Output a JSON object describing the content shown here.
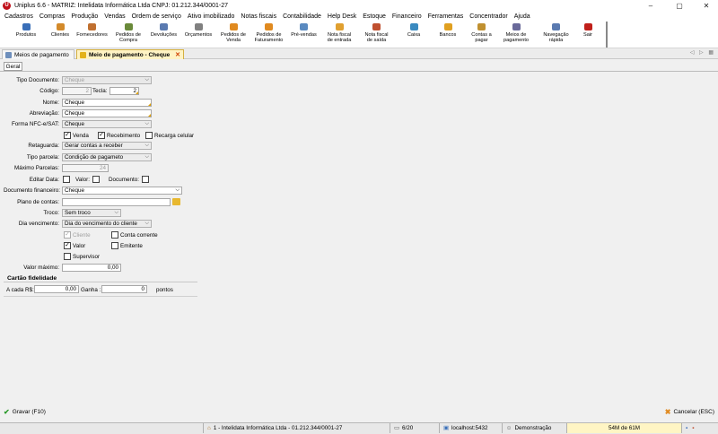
{
  "window": {
    "title": "Uniplus 6.6 - MATRIZ: Intelidata Informática Ltda CNPJ: 01.212.344/0001-27",
    "logo_letter": "U",
    "minimize": "–",
    "maximize": "▢",
    "close": "✕"
  },
  "menu": [
    "Cadastros",
    "Compras",
    "Produção",
    "Vendas",
    "Ordem de serviço",
    "Ativo imobilizado",
    "Notas fiscais",
    "Contabilidade",
    "Help Desk",
    "Estoque",
    "Financeiro",
    "Ferramentas",
    "Concentrador",
    "Ajuda"
  ],
  "toolbar": [
    {
      "label": "Produtos",
      "icon": "box-icon",
      "color": "#3a6fb8"
    },
    {
      "label": "Clientes",
      "icon": "user-icon",
      "color": "#d38a2a"
    },
    {
      "label": "Fornecedores",
      "icon": "truck-icon",
      "color": "#c07030"
    },
    {
      "label": "Pedidos de\nCompra",
      "icon": "cart-icon",
      "color": "#6a8a3a"
    },
    {
      "label": "Devoluções",
      "icon": "return-icon",
      "color": "#5a7ab0"
    },
    {
      "label": "Orçamentos",
      "icon": "calc-icon",
      "color": "#808080"
    },
    {
      "label": "Pedidos de\nVenda",
      "icon": "order-icon",
      "color": "#e08a20"
    },
    {
      "label": "Pedidos de\nFaturamento",
      "icon": "invoice-icon",
      "color": "#e08a20"
    },
    {
      "label": "Pré-vendas",
      "icon": "presale-icon",
      "color": "#5a8ac0"
    },
    {
      "label": "Nota fiscal\nde entrada",
      "icon": "nf-in-icon",
      "color": "#e0a030"
    },
    {
      "label": "Nota fiscal\nde saída",
      "icon": "nf-out-icon",
      "color": "#c05030"
    },
    {
      "label": "Caixa",
      "icon": "cashier-icon",
      "color": "#3a8ac0"
    },
    {
      "label": "Bancos",
      "icon": "bank-icon",
      "color": "#e0a020"
    },
    {
      "label": "Contas a\npagar",
      "icon": "bills-icon",
      "color": "#c09030"
    },
    {
      "label": "Meios de\npagamento",
      "icon": "payment-icon",
      "color": "#6a6a9a"
    },
    {
      "label": "Navegação\nrápida",
      "icon": "nav-icon",
      "color": "#5a7ab0"
    },
    {
      "label": "Sair",
      "icon": "exit-icon",
      "color": "#c0201a"
    }
  ],
  "tabs": {
    "tab1": "Meios de pagamento",
    "tab2": "Meio de pagamento - Cheque",
    "close": "✕",
    "nav": "◁ ▷ ▦"
  },
  "subtab": "Geral",
  "form": {
    "tipo_documento_label": "Tipo Documento:",
    "tipo_documento": "Cheque",
    "codigo_label": "Código:",
    "codigo": "2",
    "tecla_label": "Tecla:",
    "tecla": "2",
    "nome_label": "Nome:",
    "nome": "Cheque",
    "abreviacao_label": "Abreviação:",
    "abreviacao": "Cheque",
    "forma_nfce_label": "Forma NFC-e/SAT:",
    "forma_nfce": "Cheque",
    "venda": "Venda",
    "recebimento": "Recebimento",
    "recarga": "Recarga celular",
    "retaguarda_label": "Retaguarda:",
    "retaguarda": "Gerar contas a receber",
    "tipo_parcela_label": "Tipo parcela:",
    "tipo_parcela": "Condição de pagameto",
    "max_parcelas_label": "Máximo Parcelas:",
    "max_parcelas": "24",
    "editar_data_label": "Editar Data:",
    "valor_cb": "Valor:",
    "documento_cb": "Documento:",
    "doc_financeiro_label": "Documento financeiro:",
    "doc_financeiro": "Cheque",
    "plano_contas_label": "Plano de contas:",
    "plano_contas": "",
    "troco_label": "Troco:",
    "troco": "Sem troco",
    "dia_venc_label": "Dia vencimento:",
    "dia_venc": "Dia do vencimento do cliente",
    "cliente": "Cliente",
    "conta_corrente": "Conta corrente",
    "valor": "Valor",
    "emitente": "Emitente",
    "supervisor": "Supervisor",
    "valor_max_label": "Valor máximo:",
    "valor_max": "0,00"
  },
  "card": {
    "title": "Cartão fidelidade",
    "a_cada_label": "A cada R$:",
    "a_cada": "0,00",
    "ganha_label": "Ganha :",
    "ganha": "0",
    "pontos": "pontos"
  },
  "actions": {
    "save": "Gravar (F10)",
    "cancel": "Cancelar (ESC)"
  },
  "status": {
    "company": "1 - Intelidata Informática Ltda - 01.212.344/0001-27",
    "count": "6/20",
    "server": "localhost:5432",
    "user": "Demonstração",
    "memory": "54M de 61M"
  },
  "colors": {
    "accent": "#e4b21a",
    "close_red": "#c0101a",
    "save_green": "#2a9a2a",
    "cancel_orange": "#e08a20"
  }
}
